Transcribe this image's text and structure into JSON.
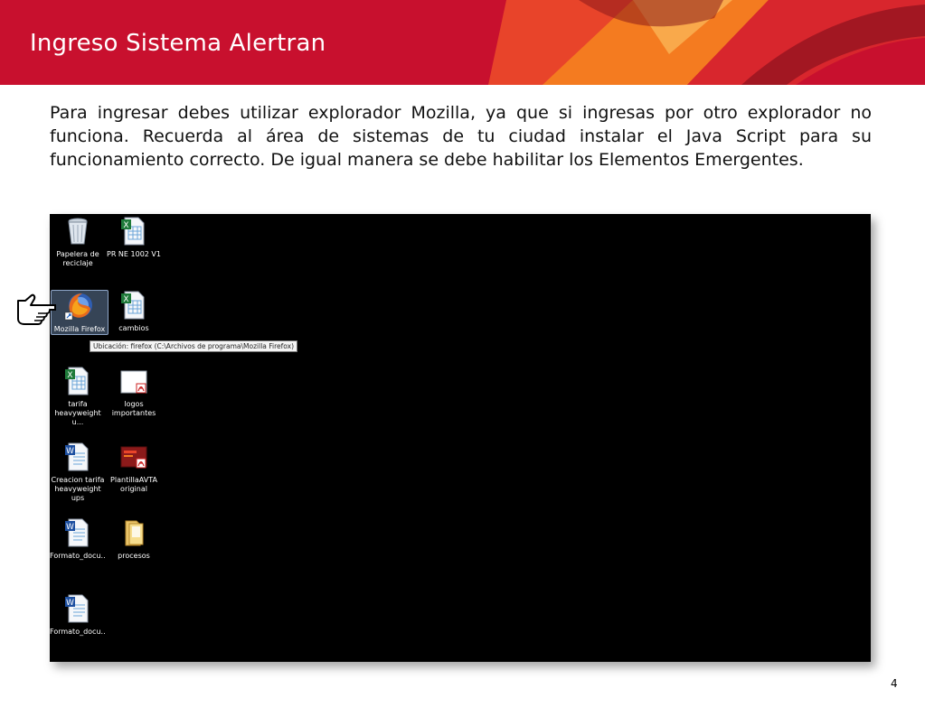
{
  "header": {
    "title": "Ingreso Sistema Alertran",
    "colors": {
      "base": "#c8102e",
      "orange": "#f47b20",
      "dark_red": "#8b1a1a"
    }
  },
  "intro_text": "Para ingresar debes utilizar explorador Mozilla, ya que si ingresas por otro explorador no funciona. Recuerda al área de sistemas de tu ciudad instalar el Java Script para su funcionamiento correcto. De igual manera se debe habilitar los Elementos Emergentes.",
  "desktop": {
    "icons": [
      {
        "id": "recycle-bin",
        "label": "Papelera de reciclaje",
        "icon": "recycle-bin-icon"
      },
      {
        "id": "pr-ne",
        "label": "PR NE 1002 V1",
        "icon": "excel-file-icon"
      },
      {
        "id": "firefox",
        "label": "Mozilla Firefox",
        "icon": "firefox-icon",
        "selected": true
      },
      {
        "id": "cambios",
        "label": "cambios",
        "icon": "excel-file-icon"
      },
      {
        "id": "tarifa",
        "label": "tarifa heavyweight u...",
        "icon": "excel-file-icon"
      },
      {
        "id": "logos",
        "label": "logos importantes",
        "icon": "pdf-file-icon"
      },
      {
        "id": "creacion",
        "label": "Creacion tarifa heavyweight ups",
        "icon": "word-file-icon"
      },
      {
        "id": "plantilla",
        "label": "PlantillaAVTA original",
        "icon": "pdf-file-icon"
      },
      {
        "id": "formato1",
        "label": "Formato_docu...",
        "icon": "word-file-icon"
      },
      {
        "id": "procesos",
        "label": "procesos",
        "icon": "folder-icon"
      },
      {
        "id": "formato2",
        "label": "Formato_docu...",
        "icon": "word-file-icon"
      }
    ],
    "tooltip": "Ubicación: firefox (C:\\Archivos de programa\\Mozilla Firefox)"
  },
  "pointer_icon": "hand-pointer-icon",
  "page_number": "4"
}
